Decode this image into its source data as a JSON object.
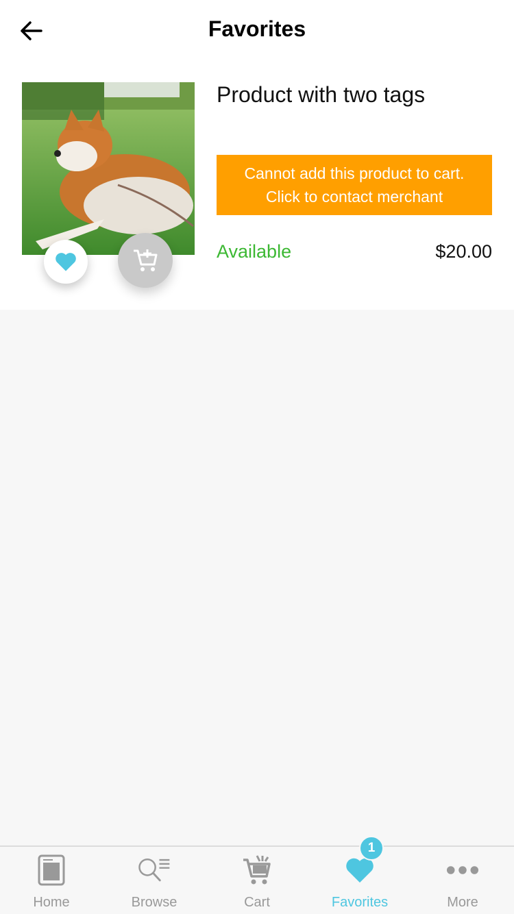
{
  "header": {
    "title": "Favorites",
    "back_icon": "arrow-left-icon"
  },
  "product": {
    "name": "Product with two tags",
    "notice_line1": "Cannot add this product to cart.",
    "notice_line2": "Click to contact merchant",
    "availability": "Available",
    "price": "$20.00",
    "image": "dog-photo",
    "favorited": true
  },
  "tabs": [
    {
      "label": "Home",
      "icon": "home-icon",
      "active": false
    },
    {
      "label": "Browse",
      "icon": "browse-icon",
      "active": false
    },
    {
      "label": "Cart",
      "icon": "cart-icon",
      "active": false
    },
    {
      "label": "Favorites",
      "icon": "heart-icon",
      "active": true,
      "badge": "1"
    },
    {
      "label": "More",
      "icon": "more-icon",
      "active": false
    }
  ],
  "colors": {
    "accent": "#4ec6e0",
    "notice": "#ff9f00",
    "available": "#3cb833",
    "inactive": "#999999"
  }
}
